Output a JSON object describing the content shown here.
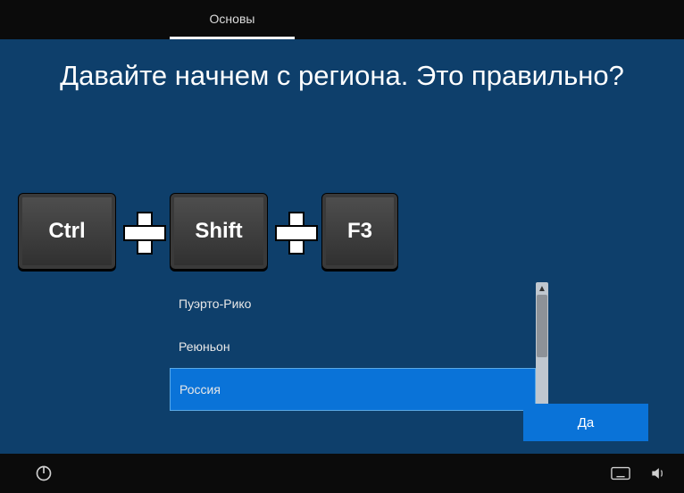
{
  "tabbar": {
    "active_tab": "Основы"
  },
  "heading": "Давайте начнем с региона. Это правильно?",
  "keycombo": {
    "keys": [
      "Ctrl",
      "Shift",
      "F3"
    ]
  },
  "list": {
    "items": [
      {
        "label": "Пуэрто-Рико",
        "selected": false
      },
      {
        "label": "Реюньон",
        "selected": false
      },
      {
        "label": "Россия",
        "selected": true
      }
    ]
  },
  "buttons": {
    "confirm": "Да"
  },
  "colors": {
    "accent": "#0a73d8",
    "background": "#0e3f6b"
  }
}
